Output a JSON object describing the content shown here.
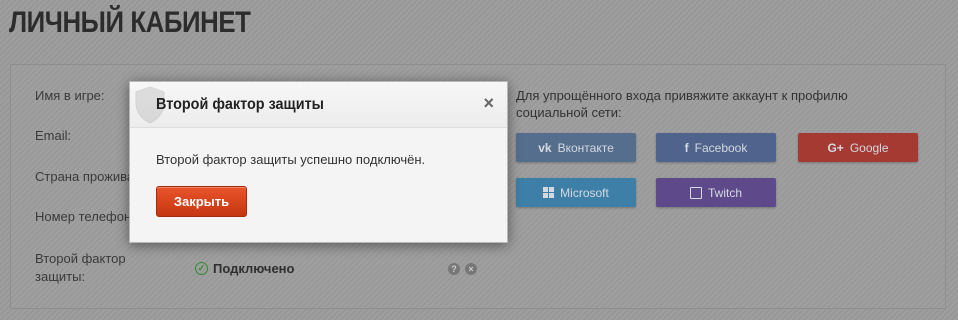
{
  "page": {
    "title": "ЛИЧНЫЙ КАБИНЕТ"
  },
  "profile": {
    "labels": {
      "name": "Имя в игре:",
      "email": "Email:",
      "country": "Страна прожива",
      "phone": "Номер телефона",
      "two_factor_line1": "Второй фактор",
      "two_factor_line2": "защиты:"
    },
    "two_factor_status": "Подключено"
  },
  "social": {
    "intro": "Для упрощённого входа привяжите аккаунт к профилю социальной сети:",
    "buttons": [
      {
        "label": "Вконтакте",
        "icon": "vk-icon",
        "color": "#566e8e"
      },
      {
        "label": "Facebook",
        "icon": "facebook-icon",
        "color": "#4f638c"
      },
      {
        "label": "Google",
        "icon": "google-plus-icon",
        "color": "#a53a33"
      },
      {
        "label": "Microsoft",
        "icon": "windows-icon",
        "color": "#3d7fa6"
      },
      {
        "label": "Twitch",
        "icon": "twitch-icon",
        "color": "#5e4a8a"
      }
    ]
  },
  "modal": {
    "title": "Второй фактор защиты",
    "message": "Второй фактор защиты успешно подключён.",
    "close_button": "Закрыть",
    "close_icon": "×"
  },
  "colors": {
    "accent": "#d6441b",
    "success": "#2e8b2e"
  }
}
